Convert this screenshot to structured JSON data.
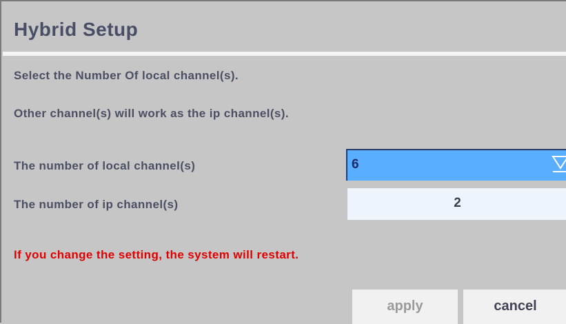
{
  "dialog": {
    "title": "Hybrid Setup",
    "instruction_line1": "Select the Number Of local channel(s).",
    "instruction_line2": "Other channel(s) will work as the ip channel(s).",
    "warning": "If you change the setting, the system will restart."
  },
  "fields": {
    "local_channels": {
      "label": "The number of local channel(s)",
      "value": "6",
      "icon": "dropdown-arrow-icon"
    },
    "ip_channels": {
      "label": "The number of ip channel(s)",
      "value": "2"
    }
  },
  "buttons": {
    "apply": "apply",
    "cancel": "cancel"
  },
  "colors": {
    "background": "#c6c6c6",
    "title": "#474e66",
    "warning": "#e10000",
    "combo_selected": "#5aaeff",
    "field_background": "#eef4fb"
  }
}
